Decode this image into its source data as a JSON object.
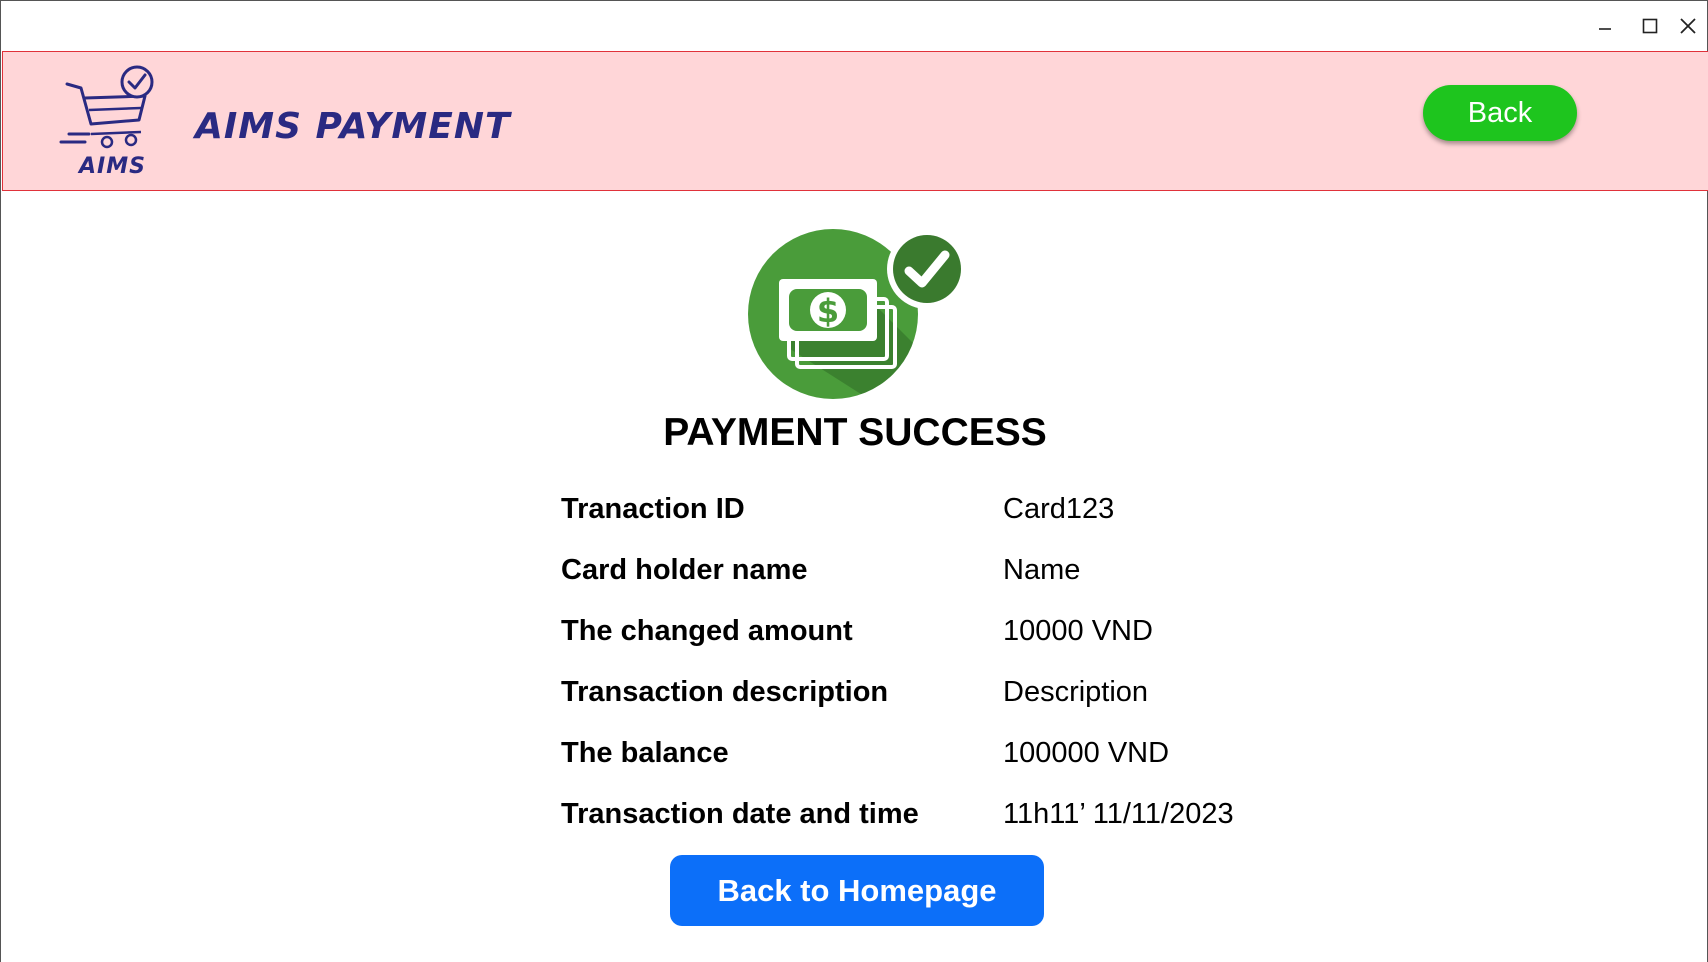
{
  "window": {
    "controls": {
      "minimize_icon": "minimize-icon",
      "maximize_icon": "maximize-icon",
      "close_icon": "close-icon"
    }
  },
  "header": {
    "logo_text": "AIMS",
    "title": "AIMS PAYMENT",
    "back_label": "Back",
    "colors": {
      "background": "#ffd6d8",
      "border": "#e0323a",
      "title": "#2a2a82",
      "back_button": "#1ec51e"
    }
  },
  "main": {
    "success_icon": "money-check-icon",
    "title": "PAYMENT SUCCESS",
    "details": [
      {
        "label": "Tranaction ID",
        "value": "Card123"
      },
      {
        "label": "Card holder name",
        "value": "Name"
      },
      {
        "label": "The changed amount",
        "value": "10000 VND"
      },
      {
        "label": "Transaction description",
        "value": "Description"
      },
      {
        "label": "The balance",
        "value": "100000 VND"
      },
      {
        "label": "Transaction date and time",
        "value": "11h11’ 11/11/2023"
      }
    ],
    "home_label": "Back to Homepage",
    "colors": {
      "home_button": "#0c6ff9",
      "icon_green": "#4a9c3a"
    }
  }
}
